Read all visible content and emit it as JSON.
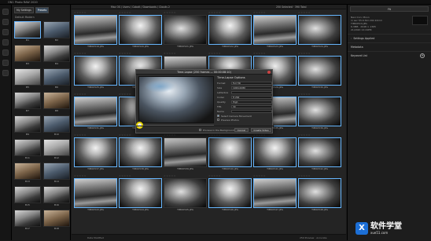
{
  "app_title": "ON1 Photo RAW 2020",
  "left_toolbar": {
    "icons": [
      "browse-icon",
      "develop-icon",
      "effects-icon",
      "portrait-icon",
      "local-icon",
      "resize-icon",
      "layers-icon"
    ]
  },
  "presets": {
    "tabs": [
      {
        "label": "My Settings"
      },
      {
        "label": "Presets"
      }
    ],
    "header": "Default Modern",
    "items": [
      {
        "label": "B1"
      },
      {
        "label": "B2"
      },
      {
        "label": "B3"
      },
      {
        "label": "B4"
      },
      {
        "label": "B5"
      },
      {
        "label": "B6"
      },
      {
        "label": "B7"
      },
      {
        "label": "B8"
      },
      {
        "label": "B9"
      },
      {
        "label": "B10"
      },
      {
        "label": "B11"
      },
      {
        "label": "B12"
      },
      {
        "label": "B13"
      },
      {
        "label": "B14"
      },
      {
        "label": "B15"
      },
      {
        "label": "B16"
      },
      {
        "label": "B17"
      },
      {
        "label": "B18"
      }
    ]
  },
  "browser": {
    "path": "Mac OS / Users / Cobalt / Downloads / Clouds 2",
    "selection": "250 Selected · 390 Total",
    "thumbnails": [
      {
        "name": "TIM00519.JPG"
      },
      {
        "name": "TIM00520.JPG"
      },
      {
        "name": "TIM00521.JPG"
      },
      {
        "name": "TIM00522.JPG"
      },
      {
        "name": "TIM00523.JPG"
      },
      {
        "name": "TIM00524.JPG"
      },
      {
        "name": "TIM00525.JPG"
      },
      {
        "name": "TIM00526.JPG"
      },
      {
        "name": "TIM00527.JPG"
      },
      {
        "name": "TIM00528.JPG"
      },
      {
        "name": "TIM00529.JPG"
      },
      {
        "name": "TIM00530.JPG"
      },
      {
        "name": "TIM00531.JPG"
      },
      {
        "name": "TIM00532.JPG"
      },
      {
        "name": "TIM00533.JPG"
      },
      {
        "name": "TIM00534.JPG"
      },
      {
        "name": "TIM00535.JPG"
      },
      {
        "name": "TIM00536.JPG"
      },
      {
        "name": "TIM00537.JPG"
      },
      {
        "name": "TIM00538.JPG"
      },
      {
        "name": "TIM00539.JPG"
      },
      {
        "name": "TIM00540.JPG"
      },
      {
        "name": "TIM00541.JPG"
      },
      {
        "name": "TIM00542.JPG"
      },
      {
        "name": "TIM00543.JPG"
      },
      {
        "name": "TIM00544.JPG"
      },
      {
        "name": "TIM00545.JPG"
      },
      {
        "name": "TIM00546.JPG"
      },
      {
        "name": "TIM00547.JPG"
      },
      {
        "name": "TIM00548.JPG"
      }
    ],
    "footer_sort": "Date Modified",
    "footer_right": "250 Preview · Accurate"
  },
  "right_panel": {
    "zoom": "Fit",
    "info_lines": [
      "Navi Con: Moon",
      "1/ sec f/5.6 ISO 200 22mm",
      "TIM00519.JPG",
      "6.3MB · 2048 × 1365",
      "21/2020 12:24PM"
    ],
    "settings_applied": "Settings Applied",
    "metadata": "Metadata",
    "keyword_list": "Keyword List"
  },
  "dialog": {
    "title": "Time-Lapse (250 frames — 00:00:08:10)",
    "options_header": "Time-Lapse Options",
    "rows": [
      {
        "label": "Format",
        "value": "Full HD"
      },
      {
        "label": "Size",
        "value": "1920x1080"
      },
      {
        "label": "Letterbox",
        "value": ""
      },
      {
        "label": "Codec",
        "value": "H.264"
      },
      {
        "label": "Quality",
        "value": "High"
      },
      {
        "label": "FPS",
        "value": "30"
      },
      {
        "label": "Name",
        "value": ""
      }
    ],
    "checks": [
      {
        "label": "Select Camera Movement",
        "on": true
      },
      {
        "label": "Preview Photos",
        "on": false
      }
    ],
    "process_bg": "Process in the Background",
    "cancel": "Cancel",
    "create": "Create Video"
  },
  "watermark": {
    "logo_letter": "X",
    "title": "软件学堂",
    "url": "xue51.com"
  }
}
